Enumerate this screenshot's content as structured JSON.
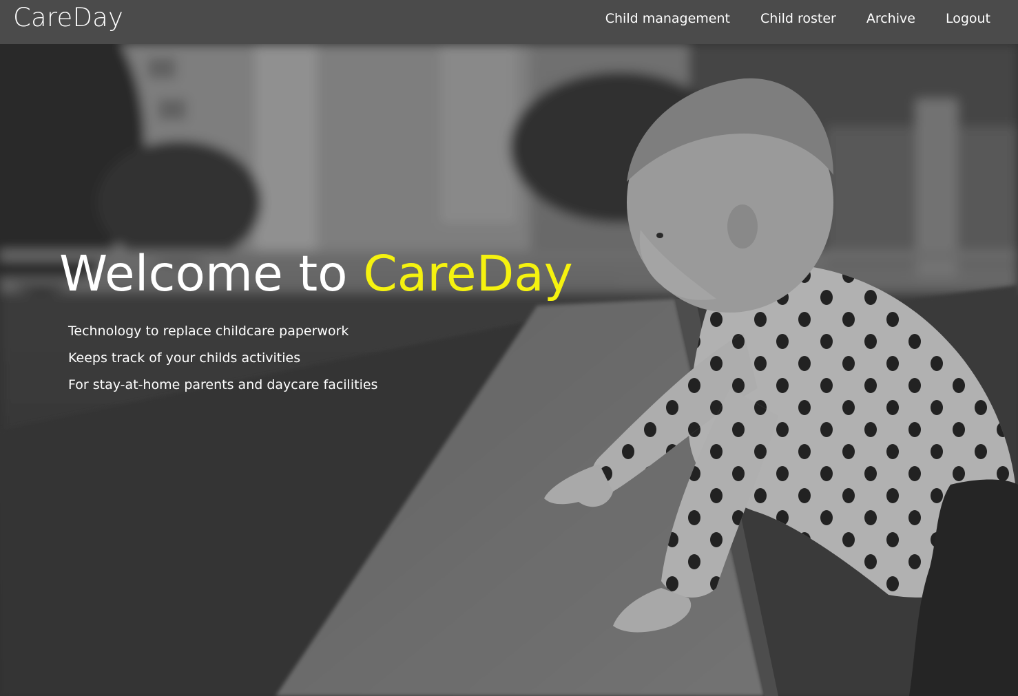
{
  "brand": {
    "name": "CareDay"
  },
  "nav": {
    "items": [
      {
        "label": "Child management"
      },
      {
        "label": "Child roster"
      },
      {
        "label": "Archive"
      },
      {
        "label": "Logout"
      }
    ]
  },
  "hero": {
    "title_prefix": "Welcome to ",
    "title_accent": "CareDay",
    "taglines": [
      "Technology to replace childcare paperwork",
      "Keeps track of your childs activities",
      "For stay-at-home parents and daycare facilities"
    ]
  },
  "colors": {
    "navbar": "#4b4b4b",
    "accent": "#f5f20f",
    "text": "#ffffff"
  }
}
